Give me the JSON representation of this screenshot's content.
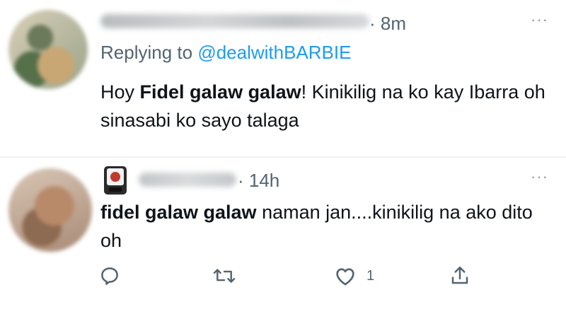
{
  "tweets": [
    {
      "time": "· 8m",
      "replying_prefix": "Replying to ",
      "replying_handle": "@dealwithBARBIE",
      "body": {
        "p1": "Hoy ",
        "b1": "Fidel galaw galaw",
        "p2": "! Kinikilig na ko kay Ibarra oh sinasabi ko sayo talaga"
      },
      "more": "···"
    },
    {
      "time": "· 14h",
      "body": {
        "b1": "fidel galaw galaw",
        "p1": " naman jan....kinikilig na ako dito oh"
      },
      "more": "···",
      "actions": {
        "like_count": "1"
      }
    }
  ],
  "icons": [
    "reply-icon",
    "retweet-icon",
    "like-icon",
    "share-icon",
    "more-icon"
  ],
  "colors": {
    "link": "#1d9bf0",
    "muted": "#536471",
    "text": "#0f1419",
    "badge": "#c0392b"
  }
}
